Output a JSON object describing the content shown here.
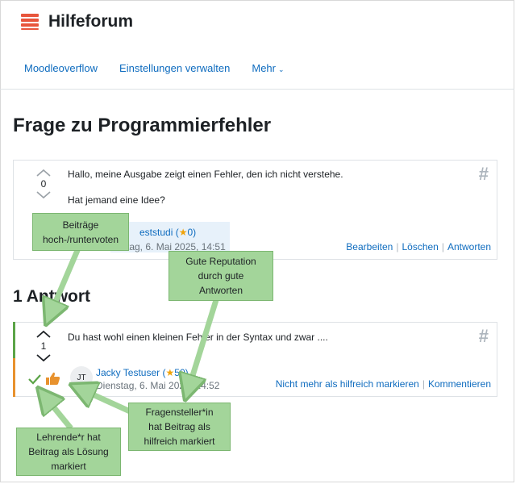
{
  "site": {
    "title": "Hilfeforum"
  },
  "nav": {
    "items": [
      "Moodleoverflow",
      "Einstellungen verwalten",
      "Mehr"
    ]
  },
  "page": {
    "title": "Frage zu Programmierfehler"
  },
  "question": {
    "votes": "0",
    "line1": "Hallo, meine Ausgabe zeigt einen Fehler, den ich nicht verstehe.",
    "line2": "Hat jemand eine Idee?",
    "author": "Teststudi",
    "author_visible": "eststudi",
    "rating": "0",
    "date_visible": "tag, 6. Mai 2025, 14:51",
    "actions": [
      "Bearbeiten",
      "Löschen",
      "Antworten"
    ]
  },
  "answers": {
    "heading": "1 Antwort",
    "answer": {
      "votes": "1",
      "text": "Du hast wohl einen kleinen Fehler in der Syntax und zwar ....",
      "avatar": "JT",
      "author": "Jacky Testuser",
      "rating": "50",
      "date": "Dienstag, 6. Mai 2025, 14:52",
      "actions": [
        "Nicht mehr als hilfreich markieren",
        "Kommentieren"
      ]
    }
  },
  "callouts": {
    "vote": [
      "Beiträge",
      "hoch-/runtervoten"
    ],
    "reputation": [
      "Gute Reputation",
      "durch gute",
      "Antworten"
    ],
    "helpful": [
      "Fragensteller*in",
      "hat Beitrag als",
      "hilfreich markiert"
    ],
    "solution": [
      "Lehrende*r hat",
      "Beitrag als Lösung",
      "markiert"
    ]
  },
  "icons": {
    "more": "chevron-down-icon",
    "hash": "hash-icon",
    "check": "check-icon",
    "thumb": "thumbs-up-icon"
  },
  "colors": {
    "link": "#0f6cbf",
    "logo": "#e8553c",
    "solution": "#5ba447",
    "helpful": "#e8922e",
    "callout": "#a3d59a"
  }
}
